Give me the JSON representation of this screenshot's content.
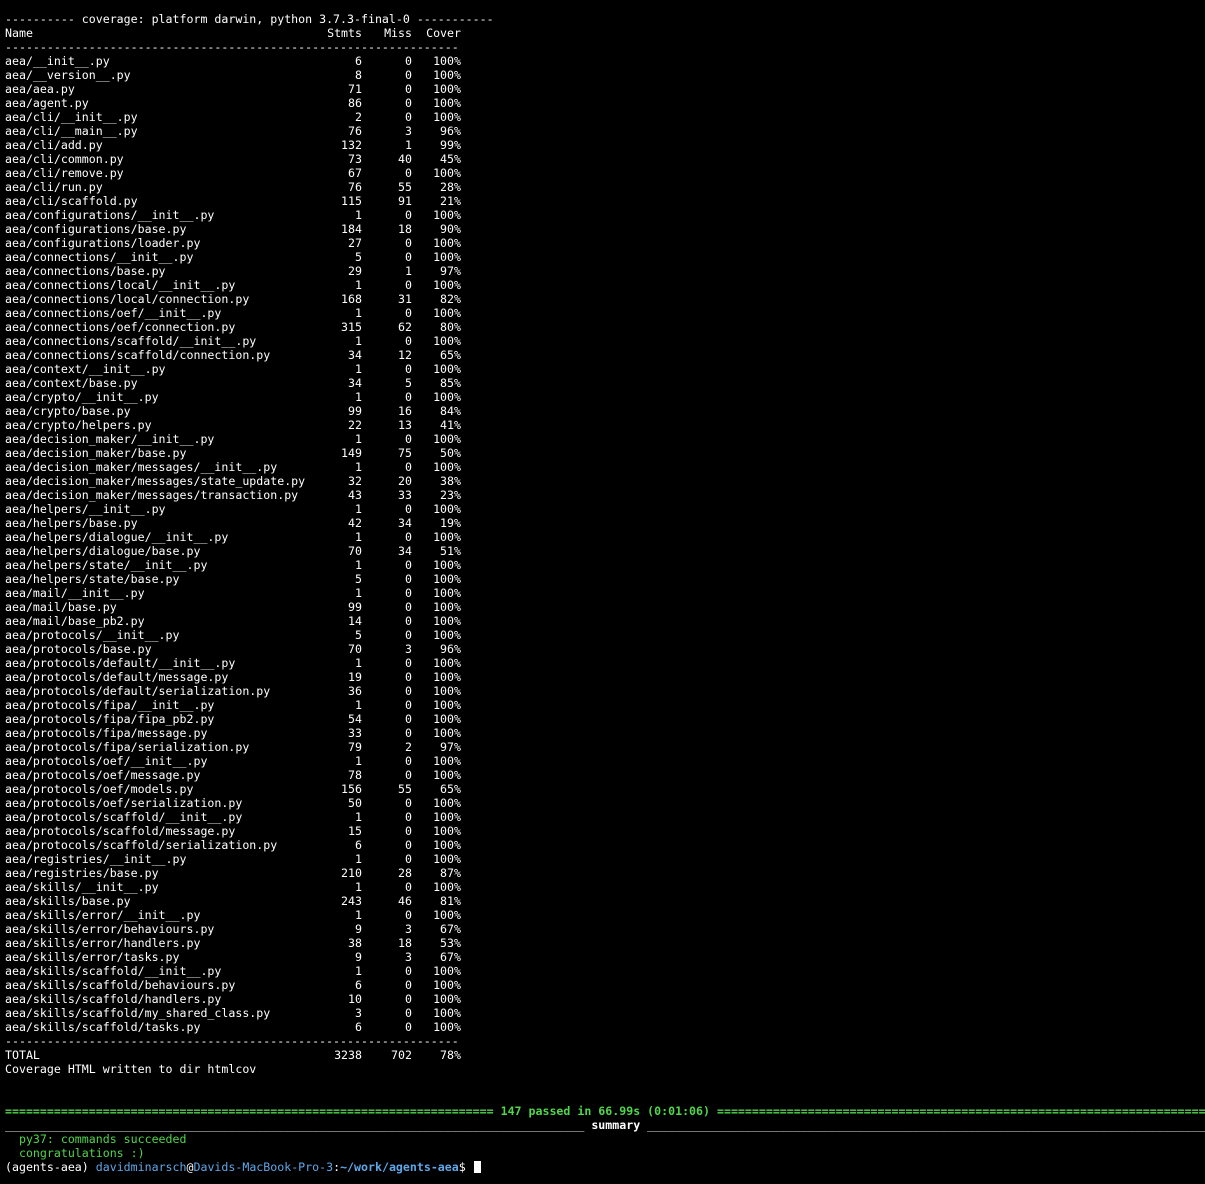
{
  "coverage_header": "---------- coverage: platform darwin, python 3.7.3-final-0 -----------",
  "columns": {
    "name": "Name",
    "stmts": "Stmts",
    "miss": "Miss",
    "cover": "Cover"
  },
  "separator": "-----------------------------------------------------------------",
  "rows": [
    {
      "name": "aea/__init__.py",
      "stmts": "6",
      "miss": "0",
      "cover": "100%"
    },
    {
      "name": "aea/__version__.py",
      "stmts": "8",
      "miss": "0",
      "cover": "100%"
    },
    {
      "name": "aea/aea.py",
      "stmts": "71",
      "miss": "0",
      "cover": "100%"
    },
    {
      "name": "aea/agent.py",
      "stmts": "86",
      "miss": "0",
      "cover": "100%"
    },
    {
      "name": "aea/cli/__init__.py",
      "stmts": "2",
      "miss": "0",
      "cover": "100%"
    },
    {
      "name": "aea/cli/__main__.py",
      "stmts": "76",
      "miss": "3",
      "cover": "96%"
    },
    {
      "name": "aea/cli/add.py",
      "stmts": "132",
      "miss": "1",
      "cover": "99%"
    },
    {
      "name": "aea/cli/common.py",
      "stmts": "73",
      "miss": "40",
      "cover": "45%"
    },
    {
      "name": "aea/cli/remove.py",
      "stmts": "67",
      "miss": "0",
      "cover": "100%"
    },
    {
      "name": "aea/cli/run.py",
      "stmts": "76",
      "miss": "55",
      "cover": "28%"
    },
    {
      "name": "aea/cli/scaffold.py",
      "stmts": "115",
      "miss": "91",
      "cover": "21%"
    },
    {
      "name": "aea/configurations/__init__.py",
      "stmts": "1",
      "miss": "0",
      "cover": "100%"
    },
    {
      "name": "aea/configurations/base.py",
      "stmts": "184",
      "miss": "18",
      "cover": "90%"
    },
    {
      "name": "aea/configurations/loader.py",
      "stmts": "27",
      "miss": "0",
      "cover": "100%"
    },
    {
      "name": "aea/connections/__init__.py",
      "stmts": "5",
      "miss": "0",
      "cover": "100%"
    },
    {
      "name": "aea/connections/base.py",
      "stmts": "29",
      "miss": "1",
      "cover": "97%"
    },
    {
      "name": "aea/connections/local/__init__.py",
      "stmts": "1",
      "miss": "0",
      "cover": "100%"
    },
    {
      "name": "aea/connections/local/connection.py",
      "stmts": "168",
      "miss": "31",
      "cover": "82%"
    },
    {
      "name": "aea/connections/oef/__init__.py",
      "stmts": "1",
      "miss": "0",
      "cover": "100%"
    },
    {
      "name": "aea/connections/oef/connection.py",
      "stmts": "315",
      "miss": "62",
      "cover": "80%"
    },
    {
      "name": "aea/connections/scaffold/__init__.py",
      "stmts": "1",
      "miss": "0",
      "cover": "100%"
    },
    {
      "name": "aea/connections/scaffold/connection.py",
      "stmts": "34",
      "miss": "12",
      "cover": "65%"
    },
    {
      "name": "aea/context/__init__.py",
      "stmts": "1",
      "miss": "0",
      "cover": "100%"
    },
    {
      "name": "aea/context/base.py",
      "stmts": "34",
      "miss": "5",
      "cover": "85%"
    },
    {
      "name": "aea/crypto/__init__.py",
      "stmts": "1",
      "miss": "0",
      "cover": "100%"
    },
    {
      "name": "aea/crypto/base.py",
      "stmts": "99",
      "miss": "16",
      "cover": "84%"
    },
    {
      "name": "aea/crypto/helpers.py",
      "stmts": "22",
      "miss": "13",
      "cover": "41%"
    },
    {
      "name": "aea/decision_maker/__init__.py",
      "stmts": "1",
      "miss": "0",
      "cover": "100%"
    },
    {
      "name": "aea/decision_maker/base.py",
      "stmts": "149",
      "miss": "75",
      "cover": "50%"
    },
    {
      "name": "aea/decision_maker/messages/__init__.py",
      "stmts": "1",
      "miss": "0",
      "cover": "100%"
    },
    {
      "name": "aea/decision_maker/messages/state_update.py",
      "stmts": "32",
      "miss": "20",
      "cover": "38%"
    },
    {
      "name": "aea/decision_maker/messages/transaction.py",
      "stmts": "43",
      "miss": "33",
      "cover": "23%"
    },
    {
      "name": "aea/helpers/__init__.py",
      "stmts": "1",
      "miss": "0",
      "cover": "100%"
    },
    {
      "name": "aea/helpers/base.py",
      "stmts": "42",
      "miss": "34",
      "cover": "19%"
    },
    {
      "name": "aea/helpers/dialogue/__init__.py",
      "stmts": "1",
      "miss": "0",
      "cover": "100%"
    },
    {
      "name": "aea/helpers/dialogue/base.py",
      "stmts": "70",
      "miss": "34",
      "cover": "51%"
    },
    {
      "name": "aea/helpers/state/__init__.py",
      "stmts": "1",
      "miss": "0",
      "cover": "100%"
    },
    {
      "name": "aea/helpers/state/base.py",
      "stmts": "5",
      "miss": "0",
      "cover": "100%"
    },
    {
      "name": "aea/mail/__init__.py",
      "stmts": "1",
      "miss": "0",
      "cover": "100%"
    },
    {
      "name": "aea/mail/base.py",
      "stmts": "99",
      "miss": "0",
      "cover": "100%"
    },
    {
      "name": "aea/mail/base_pb2.py",
      "stmts": "14",
      "miss": "0",
      "cover": "100%"
    },
    {
      "name": "aea/protocols/__init__.py",
      "stmts": "5",
      "miss": "0",
      "cover": "100%"
    },
    {
      "name": "aea/protocols/base.py",
      "stmts": "70",
      "miss": "3",
      "cover": "96%"
    },
    {
      "name": "aea/protocols/default/__init__.py",
      "stmts": "1",
      "miss": "0",
      "cover": "100%"
    },
    {
      "name": "aea/protocols/default/message.py",
      "stmts": "19",
      "miss": "0",
      "cover": "100%"
    },
    {
      "name": "aea/protocols/default/serialization.py",
      "stmts": "36",
      "miss": "0",
      "cover": "100%"
    },
    {
      "name": "aea/protocols/fipa/__init__.py",
      "stmts": "1",
      "miss": "0",
      "cover": "100%"
    },
    {
      "name": "aea/protocols/fipa/fipa_pb2.py",
      "stmts": "54",
      "miss": "0",
      "cover": "100%"
    },
    {
      "name": "aea/protocols/fipa/message.py",
      "stmts": "33",
      "miss": "0",
      "cover": "100%"
    },
    {
      "name": "aea/protocols/fipa/serialization.py",
      "stmts": "79",
      "miss": "2",
      "cover": "97%"
    },
    {
      "name": "aea/protocols/oef/__init__.py",
      "stmts": "1",
      "miss": "0",
      "cover": "100%"
    },
    {
      "name": "aea/protocols/oef/message.py",
      "stmts": "78",
      "miss": "0",
      "cover": "100%"
    },
    {
      "name": "aea/protocols/oef/models.py",
      "stmts": "156",
      "miss": "55",
      "cover": "65%"
    },
    {
      "name": "aea/protocols/oef/serialization.py",
      "stmts": "50",
      "miss": "0",
      "cover": "100%"
    },
    {
      "name": "aea/protocols/scaffold/__init__.py",
      "stmts": "1",
      "miss": "0",
      "cover": "100%"
    },
    {
      "name": "aea/protocols/scaffold/message.py",
      "stmts": "15",
      "miss": "0",
      "cover": "100%"
    },
    {
      "name": "aea/protocols/scaffold/serialization.py",
      "stmts": "6",
      "miss": "0",
      "cover": "100%"
    },
    {
      "name": "aea/registries/__init__.py",
      "stmts": "1",
      "miss": "0",
      "cover": "100%"
    },
    {
      "name": "aea/registries/base.py",
      "stmts": "210",
      "miss": "28",
      "cover": "87%"
    },
    {
      "name": "aea/skills/__init__.py",
      "stmts": "1",
      "miss": "0",
      "cover": "100%"
    },
    {
      "name": "aea/skills/base.py",
      "stmts": "243",
      "miss": "46",
      "cover": "81%"
    },
    {
      "name": "aea/skills/error/__init__.py",
      "stmts": "1",
      "miss": "0",
      "cover": "100%"
    },
    {
      "name": "aea/skills/error/behaviours.py",
      "stmts": "9",
      "miss": "3",
      "cover": "67%"
    },
    {
      "name": "aea/skills/error/handlers.py",
      "stmts": "38",
      "miss": "18",
      "cover": "53%"
    },
    {
      "name": "aea/skills/error/tasks.py",
      "stmts": "9",
      "miss": "3",
      "cover": "67%"
    },
    {
      "name": "aea/skills/scaffold/__init__.py",
      "stmts": "1",
      "miss": "0",
      "cover": "100%"
    },
    {
      "name": "aea/skills/scaffold/behaviours.py",
      "stmts": "6",
      "miss": "0",
      "cover": "100%"
    },
    {
      "name": "aea/skills/scaffold/handlers.py",
      "stmts": "10",
      "miss": "0",
      "cover": "100%"
    },
    {
      "name": "aea/skills/scaffold/my_shared_class.py",
      "stmts": "3",
      "miss": "0",
      "cover": "100%"
    },
    {
      "name": "aea/skills/scaffold/tasks.py",
      "stmts": "6",
      "miss": "0",
      "cover": "100%"
    }
  ],
  "total": {
    "name": "TOTAL",
    "stmts": "3238",
    "miss": "702",
    "cover": "78%"
  },
  "html_written": "Coverage HTML written to dir htmlcov",
  "passed_bar": {
    "left": "======================================================================",
    "text": " 147 passed in 66.99s (0:01:06) ",
    "right": "======================================================================"
  },
  "summary_bar": {
    "left": "___________________________________________________________________________________",
    "text": " summary ",
    "right": "_________________________________________________________________________________"
  },
  "tox_lines": [
    "  py37: commands succeeded",
    "  congratulations :)"
  ],
  "prompt": {
    "env": "(agents-aea) ",
    "user": "davidminarsch",
    "at": "@",
    "host": "Davids-MacBook-Pro-3",
    "colon": ":",
    "path": "~/work/agents-aea",
    "symbol": "$ "
  },
  "colors": {
    "background": "#000000",
    "text": "#ffffff",
    "success": "#4fd64a",
    "prompt": "#5fa7e8"
  }
}
